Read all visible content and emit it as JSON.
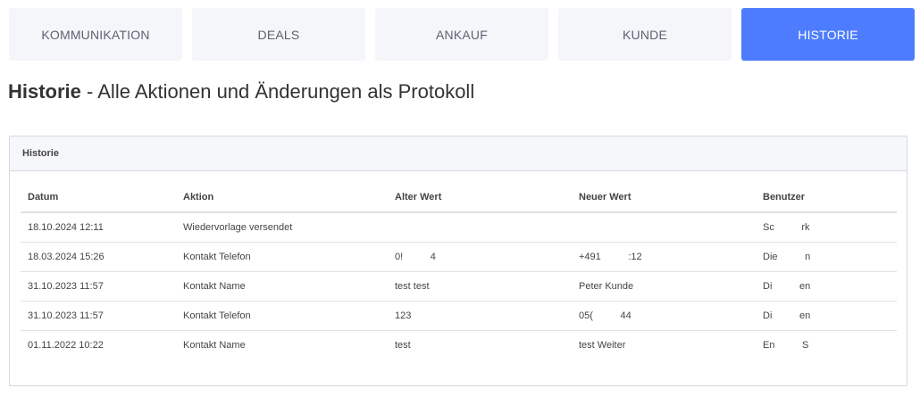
{
  "tabs": [
    {
      "label": "KOMMUNIKATION",
      "active": false
    },
    {
      "label": "DEALS",
      "active": false
    },
    {
      "label": "ANKAUF",
      "active": false
    },
    {
      "label": "KUNDE",
      "active": false
    },
    {
      "label": "HISTORIE",
      "active": true
    }
  ],
  "page": {
    "title_bold": "Historie",
    "title_rest": " - Alle Aktionen und Änderungen als Protokoll"
  },
  "panel": {
    "header": "Historie"
  },
  "table": {
    "columns": [
      "Datum",
      "Aktion",
      "Alter Wert",
      "Neuer Wert",
      "Benutzer"
    ],
    "rows": [
      [
        "18.10.2024 12:11",
        "Wiedervorlage versendet",
        "",
        "",
        "Sc          rk"
      ],
      [
        "18.03.2024 15:26",
        "Kontakt Telefon",
        "0!          4",
        "+491          :12",
        "Die          n"
      ],
      [
        "31.10.2023 11:57",
        "Kontakt Name",
        "test test",
        "Peter Kunde",
        "Di          en"
      ],
      [
        "31.10.2023 11:57",
        "Kontakt Telefon",
        "123",
        "05(          44",
        "Di          en"
      ],
      [
        "01.11.2022 10:22",
        "Kontakt Name",
        "test",
        "test Weiter",
        "En          S"
      ]
    ]
  },
  "colors": {
    "accent": "#4d7cfe",
    "tab_bg": "#f5f6fa",
    "border": "#d6d8de"
  }
}
